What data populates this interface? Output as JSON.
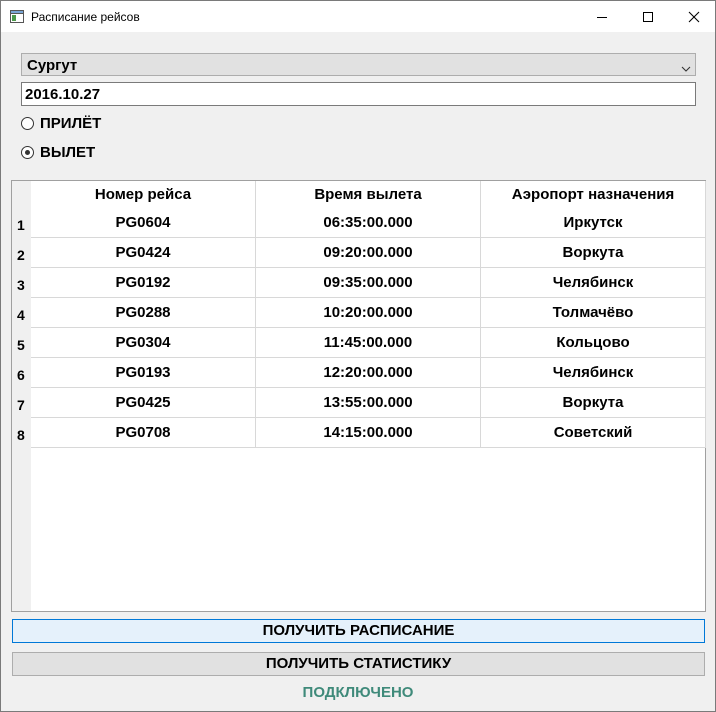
{
  "window": {
    "title": "Расписание рейсов"
  },
  "airport_select": {
    "value": "Сургут"
  },
  "date_field": {
    "value": "2016.10.27"
  },
  "direction": {
    "arrival_label": "ПРИЛЁТ",
    "departure_label": "ВЫЛЕТ",
    "selected": "departure"
  },
  "table": {
    "headers": [
      "Номер рейса",
      "Время вылета",
      "Аэропорт назначения"
    ],
    "rows": [
      {
        "num": "1",
        "flight": "PG0604",
        "time": "06:35:00.000",
        "airport": "Иркутск"
      },
      {
        "num": "2",
        "flight": "PG0424",
        "time": "09:20:00.000",
        "airport": "Воркута"
      },
      {
        "num": "3",
        "flight": "PG0192",
        "time": "09:35:00.000",
        "airport": "Челябинск"
      },
      {
        "num": "4",
        "flight": "PG0288",
        "time": "10:20:00.000",
        "airport": "Толмачёво"
      },
      {
        "num": "5",
        "flight": "PG0304",
        "time": "11:45:00.000",
        "airport": "Кольцово"
      },
      {
        "num": "6",
        "flight": "PG0193",
        "time": "12:20:00.000",
        "airport": "Челябинск"
      },
      {
        "num": "7",
        "flight": "PG0425",
        "time": "13:55:00.000",
        "airport": "Воркута"
      },
      {
        "num": "8",
        "flight": "PG0708",
        "time": "14:15:00.000",
        "airport": "Советский"
      }
    ]
  },
  "buttons": {
    "get_schedule": "ПОЛУЧИТЬ РАСПИСАНИЕ",
    "get_statistics": "ПОЛУЧИТЬ СТАТИСТИКУ"
  },
  "status": {
    "text": "ПОДКЛЮЧЕНО",
    "color": "#3f8a7a"
  },
  "colors": {
    "focus_border": "#0078d7",
    "button_bg": "#e1e1e1"
  }
}
